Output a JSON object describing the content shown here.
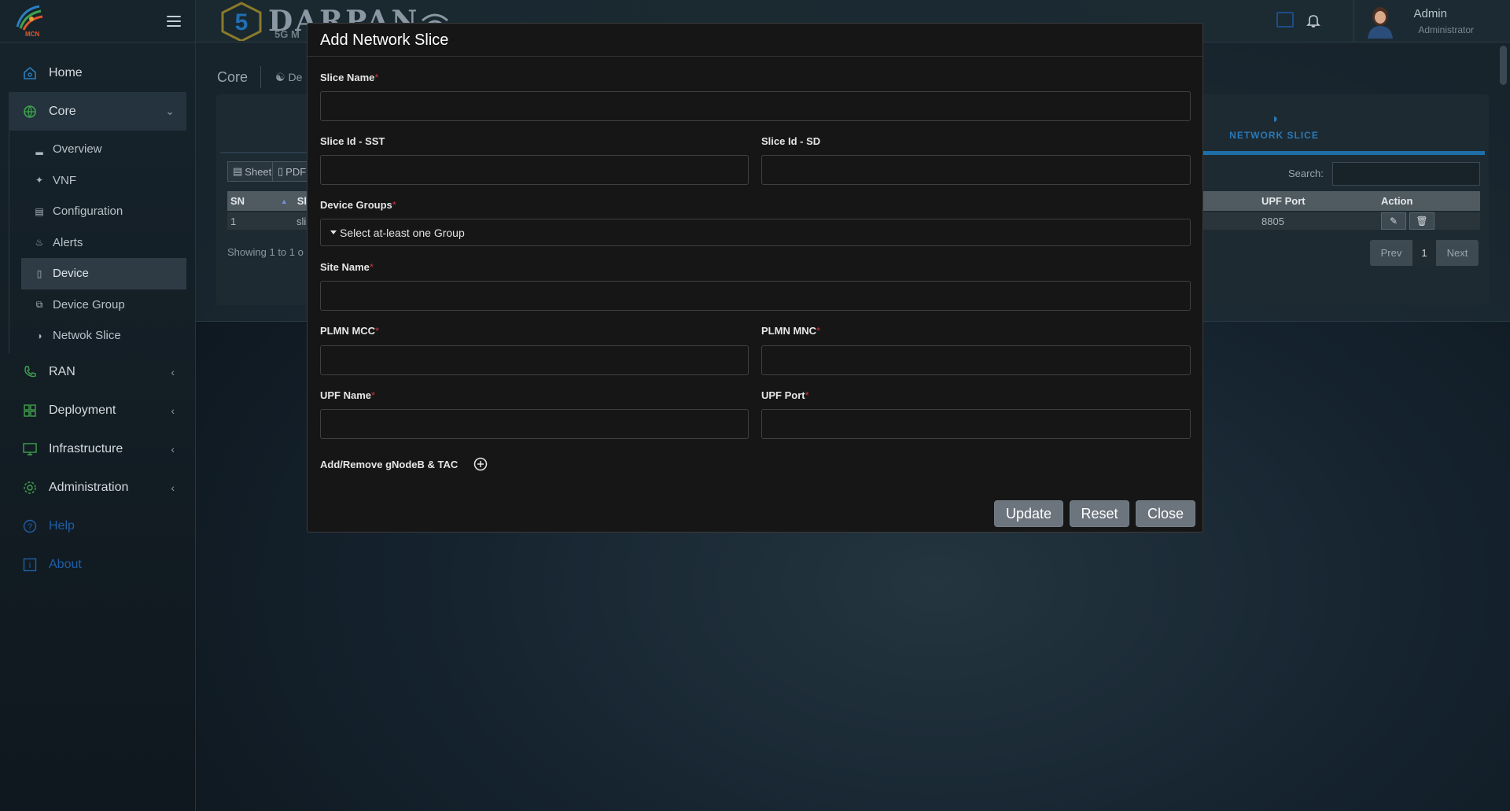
{
  "sidebar": {
    "logo_text": "MCN",
    "nav": {
      "home": "Home",
      "core": "Core",
      "ran": "RAN",
      "deployment": "Deployment",
      "infrastructure": "Infrastructure",
      "administration": "Administration",
      "help": "Help",
      "about": "About"
    },
    "core_submenu": [
      "Overview",
      "VNF",
      "Configuration",
      "Alerts",
      "Device",
      "Device Group",
      "Netwok Slice"
    ],
    "active_submenu": "Device"
  },
  "header": {
    "brand_title": "DARPAN",
    "brand_subtitle": "5G M",
    "user_name": "Admin",
    "user_role": "Administrator"
  },
  "page": {
    "breadcrumb_root": "Core",
    "breadcrumb_current": "De",
    "tab_label": "NETWORK SLICE",
    "toolbar": [
      "Sheet",
      "PDF"
    ],
    "search_label": "Search:",
    "table": {
      "headers": [
        "SN",
        "Sl",
        "UPF Port",
        "Action"
      ],
      "rows": [
        {
          "sn": "1",
          "slice": "sli",
          "upf_port": "8805"
        }
      ]
    },
    "showing_text": "Showing 1 to 1 o",
    "pager": {
      "prev": "Prev",
      "page": "1",
      "next": "Next"
    }
  },
  "modal": {
    "title": "Add Network Slice",
    "fields": {
      "slice_name": {
        "label": "Slice Name",
        "required": "*",
        "value": ""
      },
      "sst": {
        "label": "Slice Id - SST",
        "value": ""
      },
      "sd": {
        "label": "Slice Id - SD",
        "value": ""
      },
      "device_groups": {
        "label": "Device Groups",
        "required": "*",
        "selected": "Select at-least one Group"
      },
      "site_name": {
        "label": "Site Name",
        "required": "*",
        "value": ""
      },
      "plmn_mcc": {
        "label": "PLMN MCC",
        "required": "*",
        "value": ""
      },
      "plmn_mnc": {
        "label": "PLMN MNC",
        "required": "*",
        "value": ""
      },
      "upf_name": {
        "label": "UPF Name",
        "required": "*",
        "value": ""
      },
      "upf_port": {
        "label": "UPF Port",
        "required": "*",
        "value": ""
      }
    },
    "gnodeb_label": "Add/Remove gNodeB & TAC",
    "buttons": {
      "update": "Update",
      "reset": "Reset",
      "close": "Close"
    }
  },
  "colors": {
    "accent_blue": "#1e6ea8",
    "required_red": "#c8333b",
    "button_gray": "#6c757d",
    "modal_bg": "#161616"
  }
}
